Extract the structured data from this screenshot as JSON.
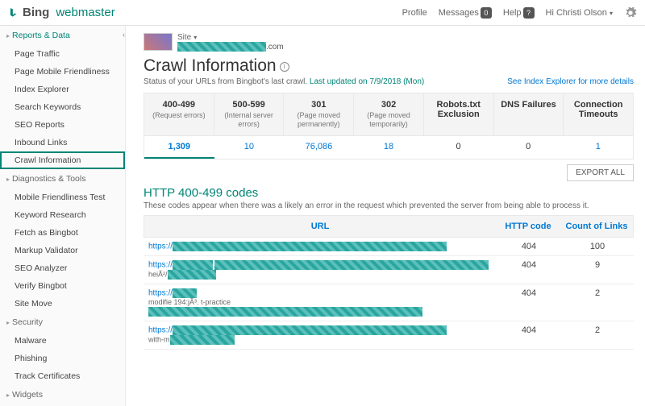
{
  "top": {
    "bing": "Bing",
    "wm": "webmaster",
    "profile": "Profile",
    "messages": "Messages",
    "msg_count": "0",
    "help": "Help",
    "help_badge": "?",
    "user": "Hi Christi Olson"
  },
  "sidebar": {
    "sec1": "Reports & Data",
    "s1": [
      "Page Traffic",
      "Page Mobile Friendliness",
      "Index Explorer",
      "Search Keywords",
      "SEO Reports",
      "Inbound Links",
      "Crawl Information"
    ],
    "sec2": "Diagnostics & Tools",
    "s2": [
      "Mobile Friendliness Test",
      "Keyword Research",
      "Fetch as Bingbot",
      "Markup Validator",
      "SEO Analyzer",
      "Verify Bingbot",
      "Site Move"
    ],
    "sec3": "Security",
    "s3": [
      "Malware",
      "Phishing",
      "Track Certificates"
    ],
    "sec4": "Widgets"
  },
  "main": {
    "site_label": "Site",
    "domain": ".com",
    "title": "Crawl Information",
    "subtitle": "Status of your URLs from Bingbot's last crawl.",
    "updated": "Last updated on 7/9/2018 (Mon)",
    "index_link": "See Index Explorer for more details",
    "stats": [
      {
        "t": "400-499",
        "s": "(Request errors)",
        "v": "1,309"
      },
      {
        "t": "500-599",
        "s": "(Internal server errors)",
        "v": "10"
      },
      {
        "t": "301",
        "s": "(Page moved permanently)",
        "v": "76,086"
      },
      {
        "t": "302",
        "s": "(Page moved temporarily)",
        "v": "18"
      },
      {
        "t": "Robots.txt Exclusion",
        "s": "",
        "v": "0"
      },
      {
        "t": "DNS Failures",
        "s": "",
        "v": "0"
      },
      {
        "t": "Connection Timeouts",
        "s": "",
        "v": "1"
      }
    ],
    "export": "EXPORT ALL",
    "section_title": "HTTP 400-499 codes",
    "section_desc": "These codes appear when there was a likely an error in the request which prevented the server from being able to process it.",
    "cols": {
      "url": "URL",
      "code": "HTTP code",
      "count": "Count of Links"
    },
    "rows": [
      {
        "prefix": "https://",
        "frag": "",
        "code": "404",
        "count": "100"
      },
      {
        "prefix": "https://",
        "frag": "heiÃ²/",
        "code": "404",
        "count": "9"
      },
      {
        "prefix": "https://",
        "frag": "modifie  194:jÃ³.  t-practice",
        "code": "404",
        "count": "2"
      },
      {
        "prefix": "https://",
        "frag": "with-m",
        "code": "404",
        "count": "2"
      }
    ]
  }
}
